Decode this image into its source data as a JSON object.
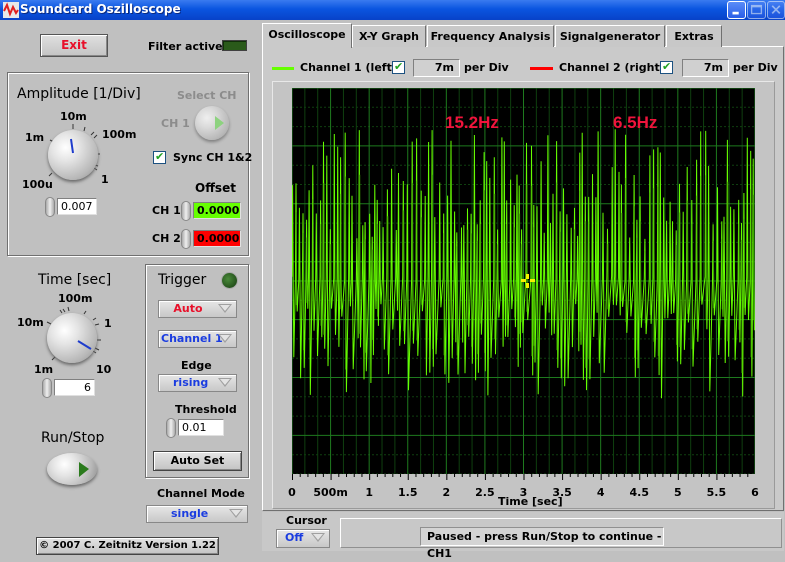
{
  "window": {
    "title": "Soundcard Oszilloscope",
    "controls": [
      "minimize",
      "maximize",
      "close"
    ]
  },
  "left_panel": {
    "exit_label": "Exit",
    "filter_label": "Filter active",
    "filter_active": false,
    "amplitude": {
      "title": "Amplitude [1/Div]",
      "knob_labels": [
        "100u",
        "1m",
        "10m",
        "100m",
        "1"
      ],
      "value": "0.007"
    },
    "select_ch": {
      "title": "Select CH",
      "value_label": "CH 1",
      "enabled": false
    },
    "sync": {
      "label": "Sync CH 1&2",
      "checked": true
    },
    "offset": {
      "title": "Offset",
      "ch1_label": "CH 1",
      "ch1_value": "0.0000",
      "ch1_color": "#66ff00",
      "ch2_label": "CH 2",
      "ch2_value": "0.0000",
      "ch2_color": "#ff0000"
    },
    "time": {
      "title": "Time [sec]",
      "knob_labels": [
        "1m",
        "10m",
        "100m",
        "1",
        "10"
      ],
      "value": "6"
    },
    "run_stop_label": "Run/Stop",
    "trigger": {
      "title": "Trigger",
      "mode": "Auto",
      "source": "Channel 1",
      "edge_label": "Edge",
      "edge": "rising",
      "threshold_label": "Threshold",
      "threshold": "0.01",
      "auto_set_label": "Auto Set"
    },
    "channel_mode": {
      "label": "Channel Mode",
      "value": "single"
    },
    "copyright": "© 2007   C. Zeitnitz Version 1.22"
  },
  "tabs": [
    {
      "label": "Oscilloscope",
      "active": true
    },
    {
      "label": "X-Y Graph",
      "active": false
    },
    {
      "label": "Frequency Analysis",
      "active": false
    },
    {
      "label": "Signalgenerator",
      "active": false
    },
    {
      "label": "Extras",
      "active": false
    }
  ],
  "legend": {
    "ch1": {
      "label": "Channel 1 (left)",
      "checked": true,
      "per_div_value": "7m",
      "per_div_label": "per Div",
      "color": "#66ff00"
    },
    "ch2": {
      "label": "Channel 2 (right)",
      "checked": true,
      "per_div_value": "7m",
      "per_div_label": "per Div",
      "color": "#ff0000"
    }
  },
  "scope": {
    "freq_ch1": "15.2Hz",
    "freq_ch2": "6.5Hz",
    "freq_color": "#f0143c",
    "trace_color": "#66ff00",
    "grid_color": "#1e7a1e",
    "background": "#000000"
  },
  "chart_data": {
    "type": "line",
    "title": "",
    "xlabel": "Time [sec]",
    "ylabel": "",
    "xlim": [
      0,
      6
    ],
    "x_ticks": [
      "0",
      "500m",
      "1",
      "1.5",
      "2",
      "2.5",
      "3",
      "3.5",
      "4",
      "4.5",
      "5",
      "5.5",
      "6"
    ],
    "y_divisions": 10,
    "grid": true,
    "series": [
      {
        "name": "Channel 1 (left)",
        "description": "dense oscillating audio signal, ~15.2Hz periodic spikes, amplitude ~±4.5 div around center"
      }
    ]
  },
  "bottom": {
    "cursor_label": "Cursor",
    "cursor_value": "Off",
    "status": "Paused - press Run/Stop to continue - CH1"
  }
}
